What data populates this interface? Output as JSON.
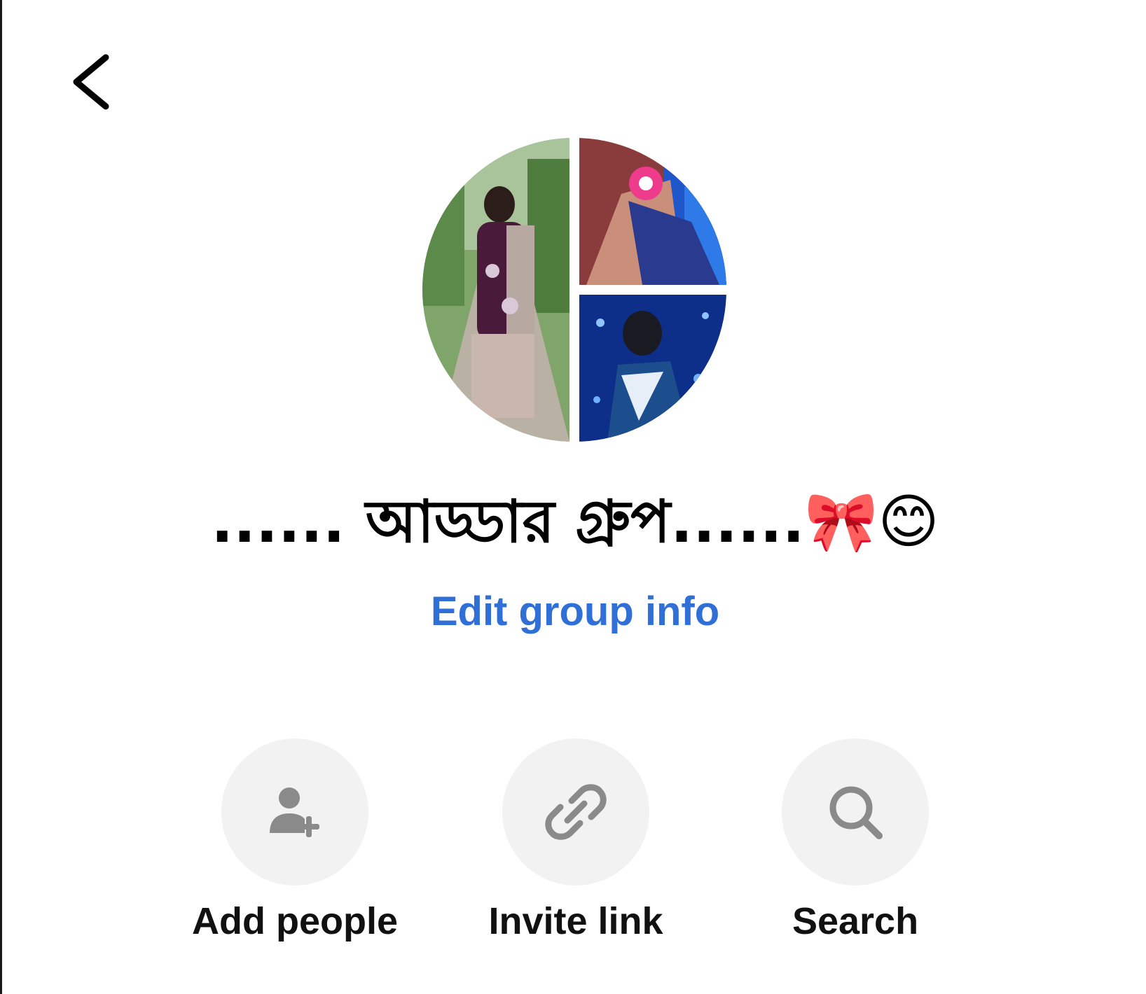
{
  "header": {
    "back_icon": "chevron-left-icon"
  },
  "group": {
    "name": "...... আড্ডার গ্রুপ......🎀😊",
    "edit_label": "Edit group info",
    "edit_color": "#2f6fd6"
  },
  "actions": [
    {
      "label": "Add people",
      "icon": "add-person-icon"
    },
    {
      "label": "Invite link",
      "icon": "link-icon"
    },
    {
      "label": "Search",
      "icon": "search-icon"
    }
  ],
  "colors": {
    "action_bg": "#f2f2f2",
    "action_icon": "#8a8a8a"
  }
}
